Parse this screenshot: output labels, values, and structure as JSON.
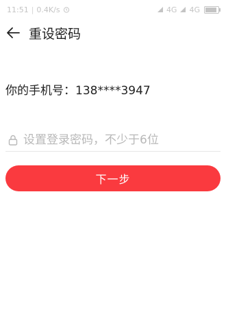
{
  "status": {
    "time": "11:51",
    "speed": "0.4K/s",
    "net1": "4G",
    "net2": "4G",
    "battery": "78",
    "battery_level": 0.78
  },
  "header": {
    "title": "重设密码",
    "back_icon": "arrow-left-icon"
  },
  "form": {
    "phone_label": "你的手机号：138****3947",
    "password_placeholder": "设置登录密码，不少于6位",
    "password_value": "",
    "lock_icon": "lock-icon"
  },
  "actions": {
    "next_label": "下一步"
  },
  "colors": {
    "accent": "#fa3a3f",
    "status_text": "#c4c4c4",
    "divider": "#e6e6e6"
  }
}
